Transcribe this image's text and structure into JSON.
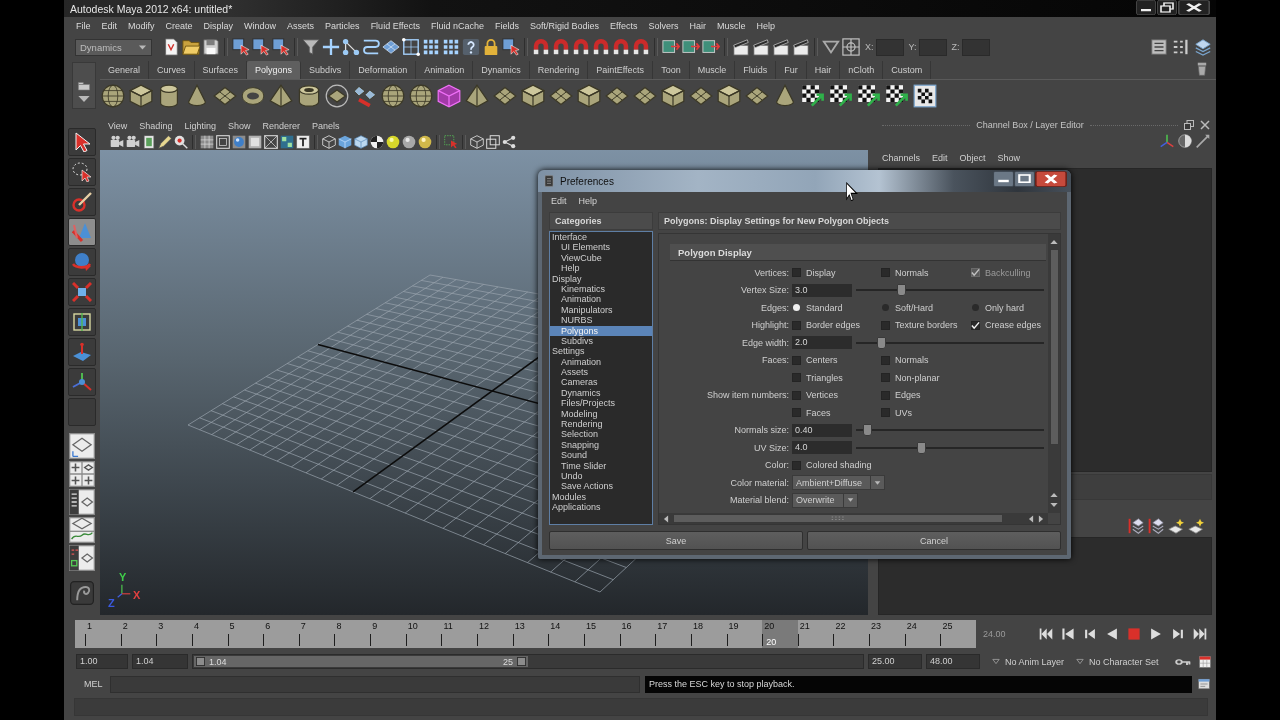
{
  "window": {
    "title": "Autodesk Maya 2012 x64: untitled*"
  },
  "menu_bar": [
    "File",
    "Edit",
    "Modify",
    "Create",
    "Display",
    "Window",
    "Assets",
    "Particles",
    "Fluid Effects",
    "Fluid nCache",
    "Fields",
    "Soft/Rigid Bodies",
    "Effects",
    "Solvers",
    "Hair",
    "Muscle",
    "Help"
  ],
  "status_line": {
    "menu_set": "Dynamics",
    "coordinate_labels": [
      "X:",
      "Y:",
      "Z:"
    ]
  },
  "shelf": {
    "tabs": [
      {
        "label": "General",
        "selected": false
      },
      {
        "label": "Curves",
        "selected": false
      },
      {
        "label": "Surfaces",
        "selected": false
      },
      {
        "label": "Polygons",
        "selected": true
      },
      {
        "label": "Subdivs",
        "selected": false
      },
      {
        "label": "Deformation",
        "selected": false
      },
      {
        "label": "Animation",
        "selected": false
      },
      {
        "label": "Dynamics",
        "selected": false
      },
      {
        "label": "Rendering",
        "selected": false
      },
      {
        "label": "PaintEffects",
        "selected": false
      },
      {
        "label": "Toon",
        "selected": false
      },
      {
        "label": "Muscle",
        "selected": false
      },
      {
        "label": "Fluids",
        "selected": false
      },
      {
        "label": "Fur",
        "selected": false
      },
      {
        "label": "Hair",
        "selected": false
      },
      {
        "label": "nCloth",
        "selected": false
      },
      {
        "label": "Custom",
        "selected": false
      }
    ]
  },
  "toolbox": {
    "tools": [
      {
        "selected": false
      },
      {
        "selected": false
      },
      {
        "selected": false
      },
      {
        "selected": true
      },
      {
        "selected": false
      },
      {
        "selected": false
      },
      {
        "selected": false
      },
      {
        "selected": false
      },
      {
        "selected": false
      },
      {
        "selected": false
      }
    ]
  },
  "viewport": {
    "menus": [
      "View",
      "Shading",
      "Lighting",
      "Show",
      "Renderer",
      "Panels"
    ],
    "axis_labels": [
      {
        "label": "Y",
        "color": "#3fcf4a"
      },
      {
        "label": "Z",
        "color": "#3a5ae0"
      },
      {
        "label": "X",
        "color": "#e04040"
      }
    ]
  },
  "channel_box": {
    "title": "Channel Box / Layer Editor",
    "menus": [
      "Channels",
      "Edit",
      "Object",
      "Show"
    ]
  },
  "preferences_dialog": {
    "title": "Preferences",
    "menus": [
      "Edit",
      "Help"
    ],
    "categories_heading": "Categories",
    "categories": [
      {
        "label": "Interface",
        "selected": false,
        "children": [
          {
            "label": "UI Elements",
            "selected": false
          },
          {
            "label": "ViewCube",
            "selected": false
          },
          {
            "label": "Help",
            "selected": false
          }
        ]
      },
      {
        "label": "Display",
        "selected": false,
        "children": [
          {
            "label": "Kinematics",
            "selected": false
          },
          {
            "label": "Animation",
            "selected": false
          },
          {
            "label": "Manipulators",
            "selected": false
          },
          {
            "label": "NURBS",
            "selected": false
          },
          {
            "label": "Polygons",
            "selected": true
          },
          {
            "label": "Subdivs",
            "selected": false
          }
        ]
      },
      {
        "label": "Settings",
        "selected": false,
        "children": [
          {
            "label": "Animation",
            "selected": false
          },
          {
            "label": "Assets",
            "selected": false
          },
          {
            "label": "Cameras",
            "selected": false
          },
          {
            "label": "Dynamics",
            "selected": false
          },
          {
            "label": "Files/Projects",
            "selected": false
          },
          {
            "label": "Modeling",
            "selected": false
          },
          {
            "label": "Rendering",
            "selected": false
          },
          {
            "label": "Selection",
            "selected": false
          },
          {
            "label": "Snapping",
            "selected": false
          },
          {
            "label": "Sound",
            "selected": false
          },
          {
            "label": "Time Slider",
            "selected": false
          },
          {
            "label": "Undo",
            "selected": false
          },
          {
            "label": "Save Actions",
            "selected": false
          }
        ]
      },
      {
        "label": "Modules",
        "selected": false
      },
      {
        "label": "Applications",
        "selected": false
      }
    ],
    "section_title": "Polygons: Display Settings for New Polygon Objects",
    "group_title": "Polygon Display",
    "rows": [
      {
        "kind": "options",
        "label": "Vertices:",
        "options": [
          {
            "kind": "checkbox",
            "label": "Display",
            "checked": false,
            "disabled": false
          },
          {
            "kind": "checkbox",
            "label": "Normals",
            "checked": false,
            "disabled": false
          },
          {
            "kind": "checkbox",
            "label": "Backculling",
            "checked": true,
            "disabled": true
          }
        ]
      },
      {
        "kind": "slider",
        "label": "Vertex Size:",
        "value": "3.0",
        "level": 0.23
      },
      {
        "kind": "options",
        "label": "Edges:",
        "options": [
          {
            "kind": "radio",
            "label": "Standard",
            "selected": true,
            "disabled": false
          },
          {
            "kind": "radio",
            "label": "Soft/Hard",
            "selected": false,
            "disabled": false
          },
          {
            "kind": "radio",
            "label": "Only hard",
            "selected": false,
            "disabled": false
          }
        ]
      },
      {
        "kind": "options",
        "label": "Highlight:",
        "options": [
          {
            "kind": "checkbox",
            "label": "Border edges",
            "checked": false,
            "disabled": false
          },
          {
            "kind": "checkbox",
            "label": "Texture borders",
            "checked": false,
            "disabled": false
          },
          {
            "kind": "checkbox",
            "label": "Crease edges",
            "checked": true,
            "disabled": false
          }
        ]
      },
      {
        "kind": "slider",
        "label": "Edge width:",
        "value": "2.0",
        "level": 0.12
      },
      {
        "kind": "options",
        "label": "Faces:",
        "options": [
          {
            "kind": "checkbox",
            "label": "Centers",
            "checked": false,
            "disabled": false
          },
          {
            "kind": "checkbox",
            "label": "Normals",
            "checked": false,
            "disabled": false
          }
        ]
      },
      {
        "kind": "options",
        "options": [
          {
            "kind": "checkbox",
            "label": "Triangles",
            "checked": false,
            "disabled": false
          },
          {
            "kind": "checkbox",
            "label": "Non-planar",
            "checked": false,
            "disabled": false
          }
        ]
      },
      {
        "kind": "options",
        "label": "Show item numbers:",
        "options": [
          {
            "kind": "checkbox",
            "label": "Vertices",
            "checked": false,
            "disabled": false
          },
          {
            "kind": "checkbox",
            "label": "Edges",
            "checked": false,
            "disabled": false
          }
        ]
      },
      {
        "kind": "options",
        "options": [
          {
            "kind": "checkbox",
            "label": "Faces",
            "checked": false,
            "disabled": false
          },
          {
            "kind": "checkbox",
            "label": "UVs",
            "checked": false,
            "disabled": false
          }
        ]
      },
      {
        "kind": "slider",
        "label": "Normals size:",
        "value": "0.40",
        "level": 0.04
      },
      {
        "kind": "slider",
        "label": "UV Size:",
        "value": "4.0",
        "level": 0.34
      },
      {
        "kind": "options",
        "label": "Color:",
        "options": [
          {
            "kind": "checkbox",
            "label": "Colored shading",
            "checked": false,
            "disabled": false
          }
        ]
      },
      {
        "kind": "dropdown",
        "label": "Color material:",
        "value": "Ambient+Diffuse"
      },
      {
        "kind": "dropdown",
        "label": "Material blend:",
        "value": "Overwrite"
      }
    ],
    "buttons": [
      "Save",
      "Cancel"
    ]
  },
  "time_slider": {
    "ticks": [
      {
        "label": "1",
        "selected": false
      },
      {
        "label": "2",
        "selected": false
      },
      {
        "label": "3",
        "selected": false
      },
      {
        "label": "4",
        "selected": false
      },
      {
        "label": "5",
        "selected": false
      },
      {
        "label": "6",
        "selected": false
      },
      {
        "label": "7",
        "selected": false
      },
      {
        "label": "8",
        "selected": false
      },
      {
        "label": "9",
        "selected": false
      },
      {
        "label": "10",
        "selected": false
      },
      {
        "label": "11",
        "selected": false
      },
      {
        "label": "12",
        "selected": false
      },
      {
        "label": "13",
        "selected": false
      },
      {
        "label": "14",
        "selected": false
      },
      {
        "label": "15",
        "selected": false
      },
      {
        "label": "16",
        "selected": false
      },
      {
        "label": "17",
        "selected": false
      },
      {
        "label": "18",
        "selected": false
      },
      {
        "label": "19",
        "selected": false
      },
      {
        "label": "20",
        "selected": true
      },
      {
        "label": "21",
        "selected": false
      },
      {
        "label": "22",
        "selected": false
      },
      {
        "label": "23",
        "selected": false
      },
      {
        "label": "24",
        "selected": false
      },
      {
        "label": "25",
        "selected": false
      }
    ],
    "current_frame": "20",
    "end_time": "24.00"
  },
  "range_slider": {
    "start_time": "1.00",
    "range_start": "1.04",
    "bar_start": "1.04",
    "bar_end": "25",
    "level": 0.5,
    "range_end": "25.00",
    "end_time": "48.00",
    "anim_layer": "No Anim Layer",
    "character_set": "No Character Set"
  },
  "command_line": {
    "language": "MEL",
    "feedback": "Press the ESC key to stop playback."
  }
}
